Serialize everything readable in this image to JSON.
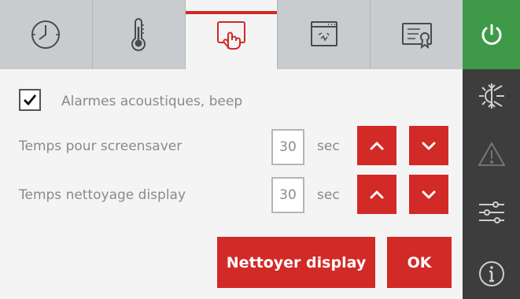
{
  "tabs": [
    {
      "icon": "clock-icon",
      "active": false
    },
    {
      "icon": "thermometer-icon",
      "active": false
    },
    {
      "icon": "touch-screen-icon",
      "active": true
    },
    {
      "icon": "display-cleaning-icon",
      "active": false
    },
    {
      "icon": "certificate-icon",
      "active": false
    }
  ],
  "sidebar": {
    "items": [
      {
        "icon": "power-icon",
        "color": "#3e9a49"
      },
      {
        "icon": "sun-snowflake-icon"
      },
      {
        "icon": "warning-icon"
      },
      {
        "icon": "sliders-icon"
      },
      {
        "icon": "info-icon"
      }
    ]
  },
  "settings": {
    "beep": {
      "label": "Alarmes acoustiques, beep",
      "checked": true
    },
    "screensaver": {
      "label": "Temps pour screensaver",
      "value": "30",
      "unit": "sec"
    },
    "cleaning": {
      "label": "Temps nettoyage display",
      "value": "30",
      "unit": "sec"
    }
  },
  "actions": {
    "clean_label": "Nettoyer display",
    "ok_label": "OK"
  },
  "colors": {
    "accent": "#d12a27",
    "power": "#3e9a49",
    "sidebar": "#3d3d3d",
    "tabbar": "#c9ccce"
  }
}
